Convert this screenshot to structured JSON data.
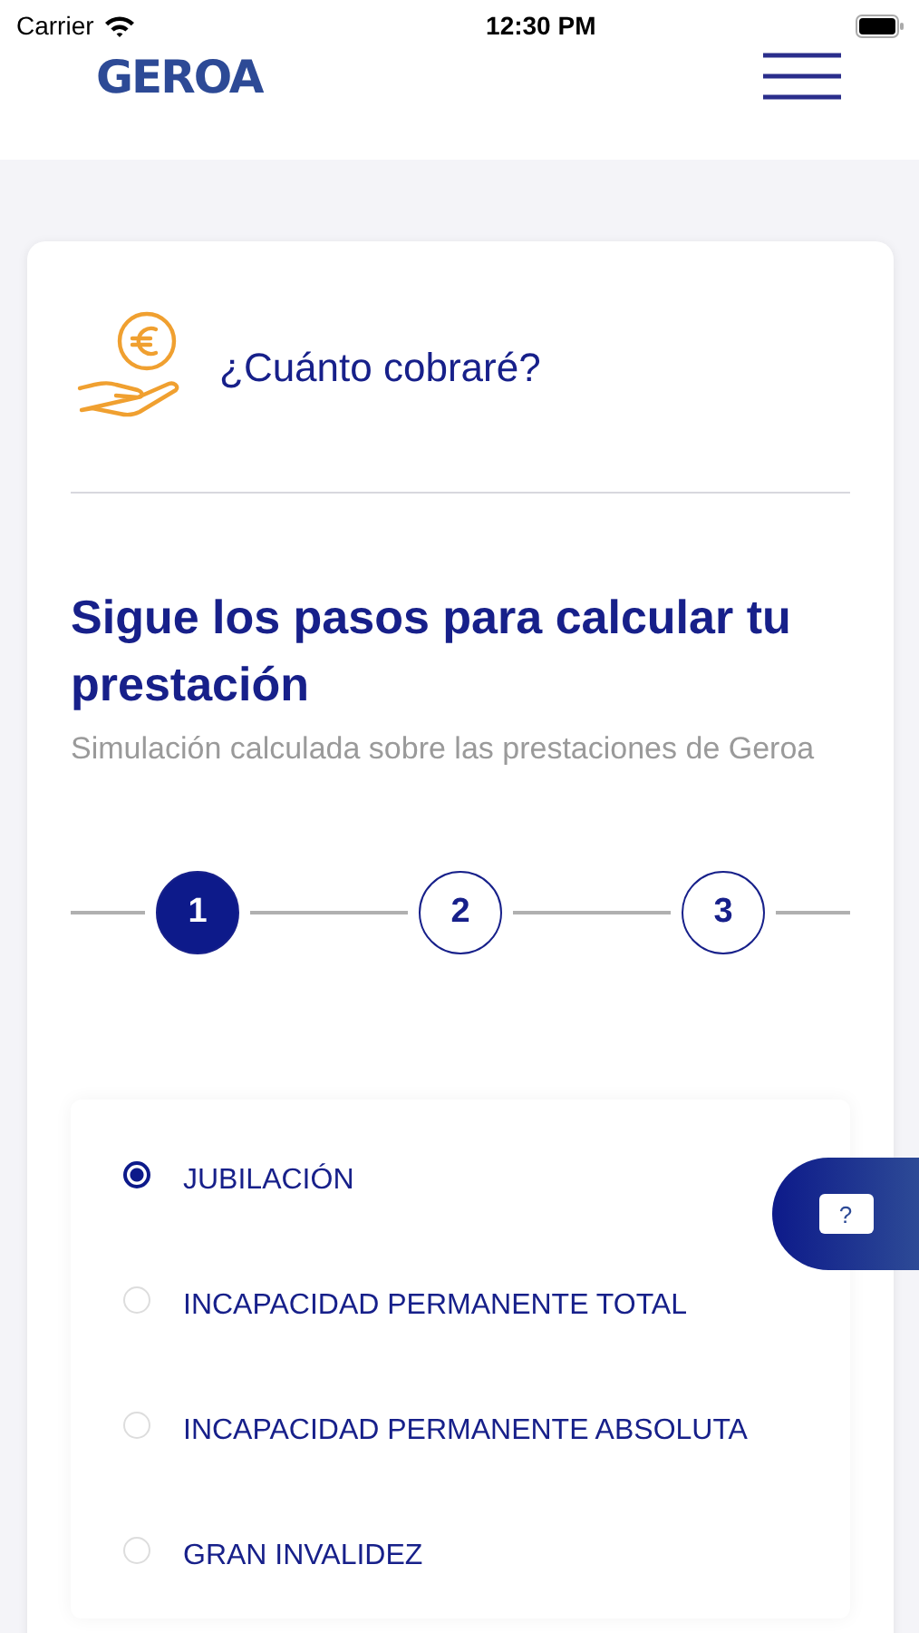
{
  "status_bar": {
    "carrier": "Carrier",
    "time": "12:30 PM"
  },
  "header": {
    "logo": "GEROA"
  },
  "card": {
    "title": "¿Cuánto cobraré?",
    "heading": "Sigue los pasos para calcular tu prestación",
    "subtitle": "Simulación calculada sobre las prestaciones de Geroa",
    "steps": [
      {
        "label": "1",
        "selected": true
      },
      {
        "label": "2",
        "selected": false
      },
      {
        "label": "3",
        "selected": false
      }
    ],
    "options": [
      {
        "label": "JUBILACIÓN",
        "selected": true
      },
      {
        "label": "INCAPACIDAD PERMANENTE TOTAL",
        "selected": false
      },
      {
        "label": "INCAPACIDAD PERMANENTE ABSOLUTA",
        "selected": false
      },
      {
        "label": "GRAN INVALIDEZ",
        "selected": false
      }
    ]
  },
  "help_button": {
    "label": "?"
  }
}
